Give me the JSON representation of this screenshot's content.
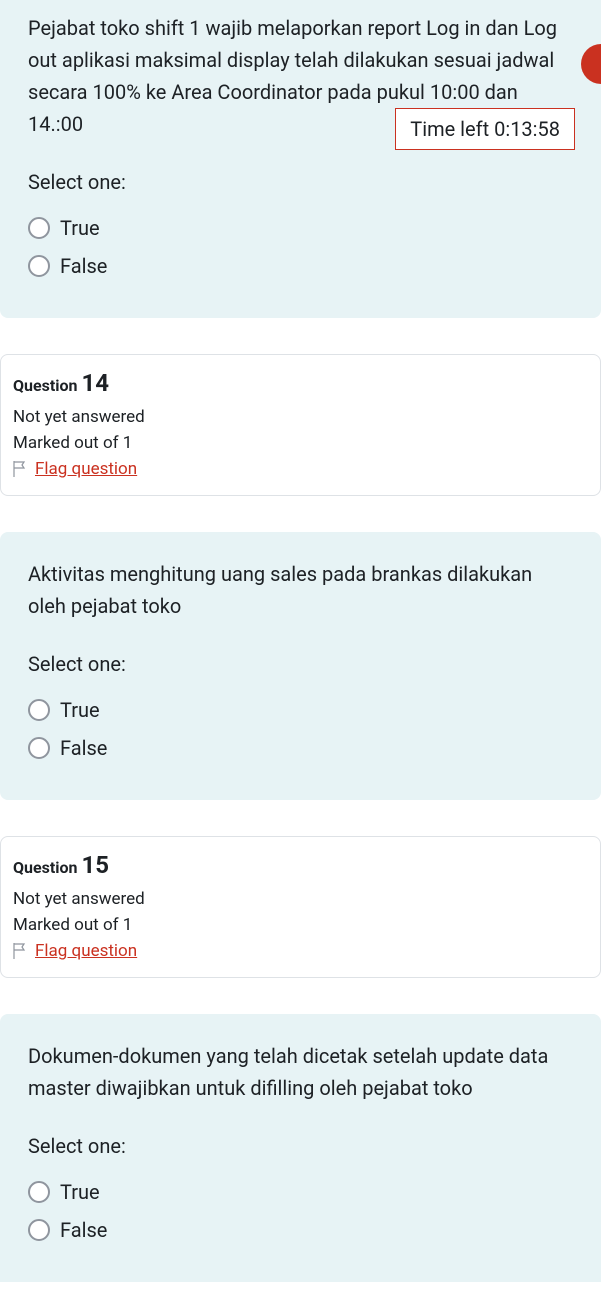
{
  "timer": {
    "label": "Time left 0:13:58"
  },
  "selectOneLabel": "Select one:",
  "trueLabel": "True",
  "falseLabel": "False",
  "flagLabel": "Flag question",
  "questionWord": "Question",
  "q13": {
    "text": "Pejabat toko shift 1 wajib melaporkan report Log in dan Log out aplikasi maksimal display telah dilakukan sesuai jadwal secara 100% ke Area Coordinator pada pukul 10:00 dan 14.:00"
  },
  "q14": {
    "number": "14",
    "status": "Not yet answered",
    "marks": "Marked out of 1",
    "text": "Aktivitas menghitung uang sales pada brankas dilakukan oleh pejabat toko"
  },
  "q15": {
    "number": "15",
    "status": "Not yet answered",
    "marks": "Marked out of 1",
    "text": "Dokumen-dokumen yang telah dicetak setelah update data master diwajibkan untuk difilling oleh pejabat toko"
  }
}
